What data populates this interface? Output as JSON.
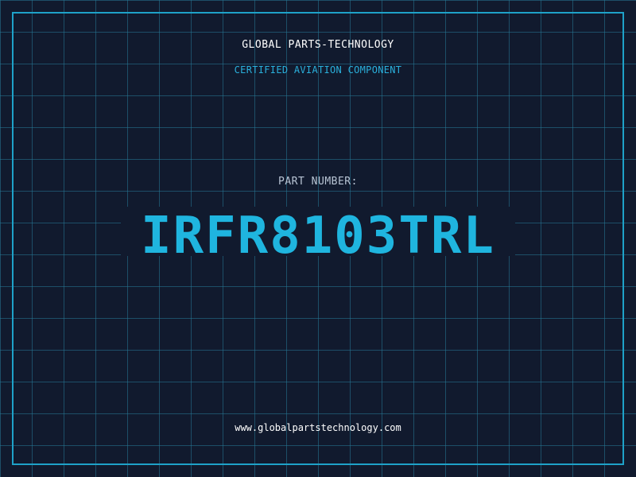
{
  "header": {
    "brand": "GLOBAL PARTS-TECHNOLOGY",
    "tagline": "CERTIFIED AVIATION COMPONENT"
  },
  "part": {
    "label": "PART NUMBER:",
    "number": "IRFR8103TRL"
  },
  "footer": {
    "website": "www.globalpartstechnology.com"
  },
  "colors": {
    "background": "#111a2e",
    "grid": "#26789a",
    "accent": "#1fb5df",
    "border": "#1ea2c9",
    "label": "#b8c4d4",
    "text": "#ffffff"
  }
}
